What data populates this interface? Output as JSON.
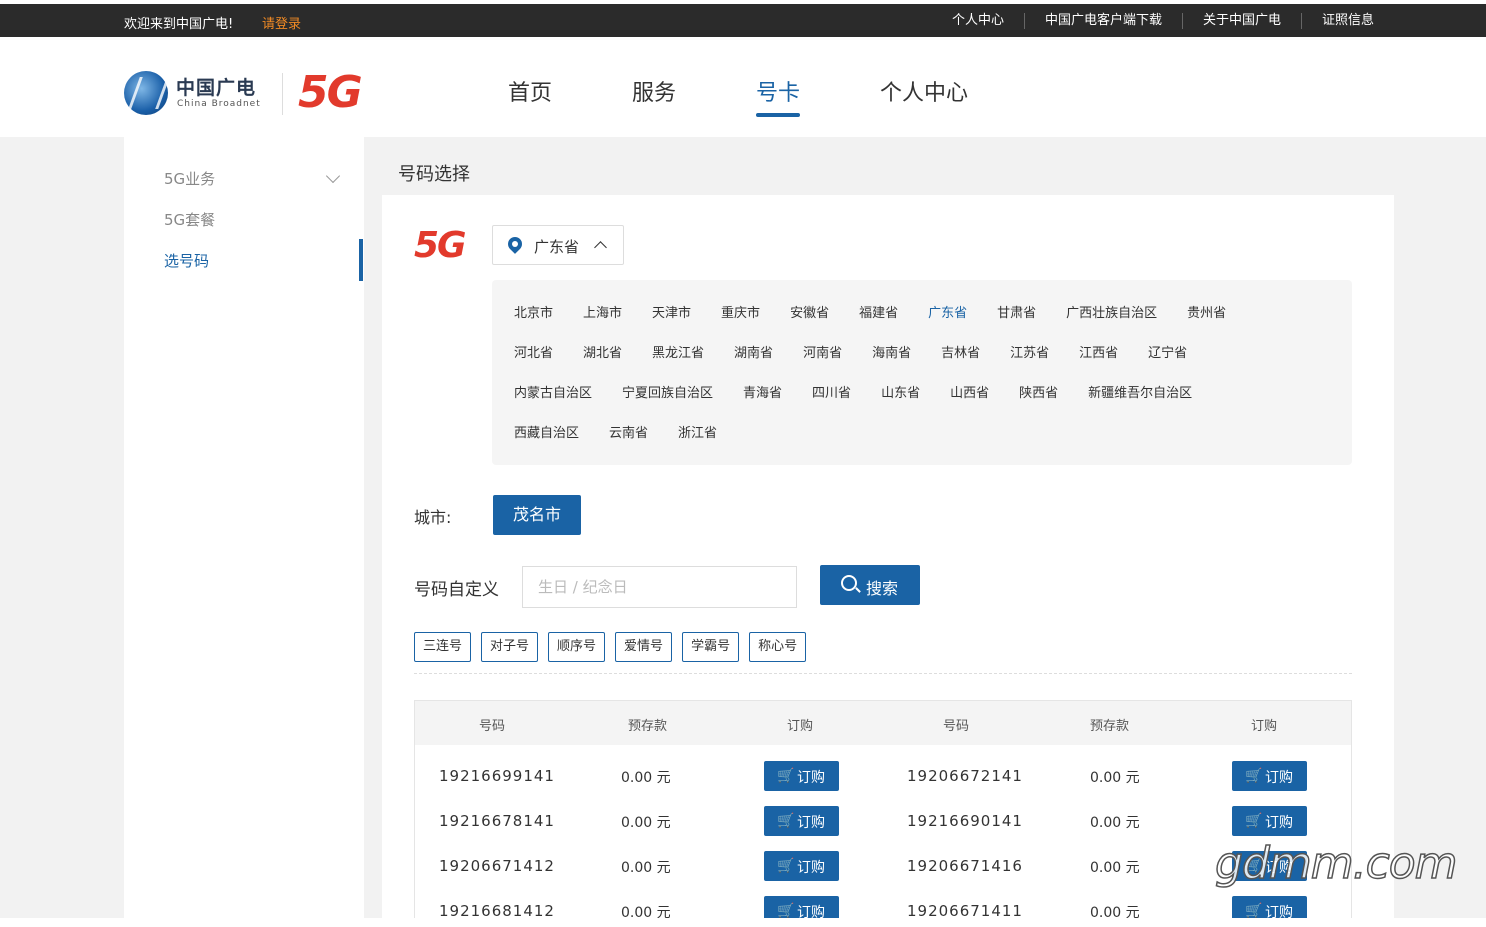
{
  "topbar": {
    "welcome": "欢迎来到中国广电!",
    "login": "请登录",
    "links": [
      "个人中心",
      "中国广电客户端下载",
      "关于中国广电",
      "证照信息"
    ]
  },
  "header": {
    "logo_cn": "中国广电",
    "logo_en": "China Broadnet",
    "logo_5g": "5G",
    "nav": [
      "首页",
      "服务",
      "号卡",
      "个人中心"
    ],
    "nav_active": "号卡"
  },
  "sidebar": {
    "items": [
      {
        "label": "5G业务"
      },
      {
        "label": "5G套餐"
      },
      {
        "label": "选号码"
      }
    ],
    "active": "选号码"
  },
  "main": {
    "title": "号码选择",
    "badge_5g": "5G",
    "province_selected": "广东省",
    "province_rows": [
      [
        "北京市",
        "上海市",
        "天津市",
        "重庆市",
        "安徽省",
        "福建省",
        "广东省",
        "甘肃省",
        "广西壮族自治区",
        "贵州省"
      ],
      [
        "河北省",
        "湖北省",
        "黑龙江省",
        "湖南省",
        "河南省",
        "海南省",
        "吉林省",
        "江苏省",
        "江西省",
        "辽宁省"
      ],
      [
        "内蒙古自治区",
        "宁夏回族自治区",
        "青海省",
        "四川省",
        "山东省",
        "山西省",
        "陕西省",
        "新疆维吾尔自治区"
      ],
      [
        "西藏自治区",
        "云南省",
        "浙江省"
      ]
    ],
    "city_label": "城市:",
    "city": "茂名市",
    "custom_label": "号码自定义",
    "custom_placeholder": "生日 / 纪念日",
    "search_label": "搜索",
    "tags": [
      "三连号",
      "对子号",
      "顺序号",
      "爱情号",
      "学霸号",
      "称心号"
    ],
    "table": {
      "headers": [
        "号码",
        "预存款",
        "订购",
        "号码",
        "预存款",
        "订购"
      ],
      "buy_label": "订购",
      "rows": [
        {
          "left": {
            "number": "19216699141",
            "price": "0.00 元"
          },
          "right": {
            "number": "19206672141",
            "price": "0.00 元"
          }
        },
        {
          "left": {
            "number": "19216678141",
            "price": "0.00 元"
          },
          "right": {
            "number": "19216690141",
            "price": "0.00 元"
          }
        },
        {
          "left": {
            "number": "19206671412",
            "price": "0.00 元"
          },
          "right": {
            "number": "19206671416",
            "price": "0.00 元"
          }
        },
        {
          "left": {
            "number": "19216681412",
            "price": "0.00 元"
          },
          "right": {
            "number": "19206671411",
            "price": "0.00 元"
          }
        }
      ]
    }
  },
  "watermark": "gdmm.com"
}
